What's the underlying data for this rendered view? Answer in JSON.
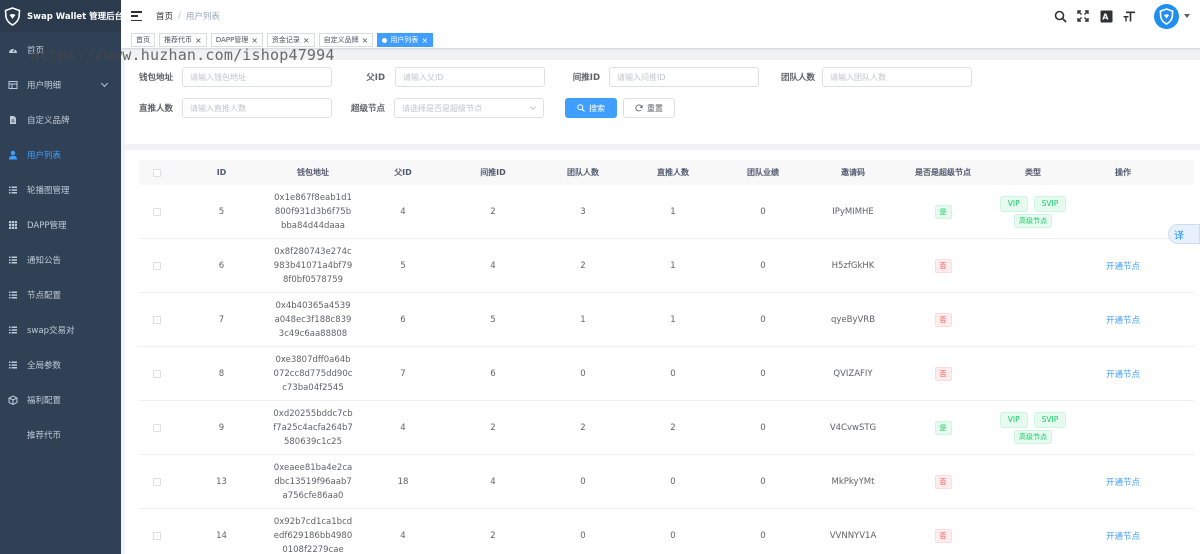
{
  "app": {
    "title": "Swap Wallet 管理后台"
  },
  "watermark": "https://www.huzhan.com/ishop47994",
  "sidebar": {
    "items": [
      {
        "label": "首页",
        "icon": "dashboard-icon",
        "active": false,
        "has_arrow": false
      },
      {
        "label": "用户明细",
        "icon": "table-icon",
        "active": false,
        "has_arrow": true
      },
      {
        "label": "自定义品牌",
        "icon": "document-icon",
        "active": false,
        "has_arrow": false
      },
      {
        "label": "用户列表",
        "icon": "user-icon",
        "active": true,
        "has_arrow": false
      },
      {
        "label": "轮播图管理",
        "icon": "list-icon",
        "active": false,
        "has_arrow": false
      },
      {
        "label": "DAPP管理",
        "icon": "grid-icon",
        "active": false,
        "has_arrow": false
      },
      {
        "label": "通知公告",
        "icon": "list-icon",
        "active": false,
        "has_arrow": false
      },
      {
        "label": "节点配置",
        "icon": "list-icon",
        "active": false,
        "has_arrow": false
      },
      {
        "label": "swap交易对",
        "icon": "list-icon",
        "active": false,
        "has_arrow": false
      },
      {
        "label": "全局参数",
        "icon": "list-icon",
        "active": false,
        "has_arrow": false
      },
      {
        "label": "福利配置",
        "icon": "box-icon",
        "active": false,
        "has_arrow": false
      },
      {
        "label": "推荐代币",
        "icon": "",
        "active": false,
        "has_arrow": false
      }
    ]
  },
  "navbar": {
    "breadcrumb": [
      "首页",
      "用户列表"
    ]
  },
  "tags": [
    {
      "label": "首页",
      "closable": false,
      "active": false
    },
    {
      "label": "推荐代币",
      "closable": true,
      "active": false
    },
    {
      "label": "DAPP管理",
      "closable": true,
      "active": false
    },
    {
      "label": "资金记录",
      "closable": true,
      "active": false
    },
    {
      "label": "自定义品牌",
      "closable": true,
      "active": false
    },
    {
      "label": "用户列表",
      "closable": true,
      "active": true
    }
  ],
  "search": {
    "fields": {
      "wallet": {
        "label": "钱包地址",
        "placeholder": "请输入钱包地址"
      },
      "parent": {
        "label": "父ID",
        "placeholder": "请输入父ID"
      },
      "indirect": {
        "label": "间推ID",
        "placeholder": "请输入间推ID"
      },
      "team": {
        "label": "团队人数",
        "placeholder": "请输入团队人数"
      },
      "direct": {
        "label": "直推人数",
        "placeholder": "请输入直推人数"
      },
      "super": {
        "label": "超级节点",
        "placeholder": "请选择是否是超级节点"
      }
    },
    "search_button": "搜索",
    "reset_button": "重置"
  },
  "table": {
    "columns": [
      "ID",
      "钱包地址",
      "父ID",
      "间推ID",
      "团队人数",
      "直推人数",
      "团队业绩",
      "邀请码",
      "是否是超级节点",
      "类型",
      "操作"
    ],
    "rows": [
      {
        "id": "5",
        "wallet": "0x1e867f8eab1d1800f931d3b6f75bbba84d44daaa",
        "parent": "4",
        "indirect": "2",
        "team": "3",
        "direct": "1",
        "perf": "0",
        "code": "IPyMIMHE",
        "super": "是",
        "is_super": true,
        "types": [
          "VIP",
          "SVIP",
          "高级节点"
        ],
        "action": ""
      },
      {
        "id": "6",
        "wallet": "0x8f280743e274c983b41071a4bf798f0bf0578759",
        "parent": "5",
        "indirect": "4",
        "team": "2",
        "direct": "1",
        "perf": "0",
        "code": "H5zfGkHK",
        "super": "否",
        "is_super": false,
        "types": [],
        "action": "开通节点"
      },
      {
        "id": "7",
        "wallet": "0x4b40365a4539a048ec3f188c8393c49c6aa88808",
        "parent": "6",
        "indirect": "5",
        "team": "1",
        "direct": "1",
        "perf": "0",
        "code": "qyeByVRB",
        "super": "否",
        "is_super": false,
        "types": [],
        "action": "开通节点"
      },
      {
        "id": "8",
        "wallet": "0xe3807dff0a64b072cc8d775dd90cc73ba04f2545",
        "parent": "7",
        "indirect": "6",
        "team": "0",
        "direct": "0",
        "perf": "0",
        "code": "QVIZAFIY",
        "super": "否",
        "is_super": false,
        "types": [],
        "action": "开通节点"
      },
      {
        "id": "9",
        "wallet": "0xd20255bddc7cbf7a25c4acfa264b7580639c1c25",
        "parent": "4",
        "indirect": "2",
        "team": "2",
        "direct": "2",
        "perf": "0",
        "code": "V4CvwSTG",
        "super": "是",
        "is_super": true,
        "types": [
          "VIP",
          "SVIP",
          "高级节点"
        ],
        "action": ""
      },
      {
        "id": "13",
        "wallet": "0xeaee81ba4e2cadbc13519f96aab7a756cfe86aa0",
        "parent": "18",
        "indirect": "4",
        "team": "0",
        "direct": "0",
        "perf": "0",
        "code": "MkPkyYMt",
        "super": "否",
        "is_super": false,
        "types": [],
        "action": "开通节点"
      },
      {
        "id": "14",
        "wallet": "0x92b7cd1ca1bcdedf629186bb49800108f2279cae",
        "parent": "4",
        "indirect": "2",
        "team": "0",
        "direct": "0",
        "perf": "0",
        "code": "VVNNYV1A",
        "super": "否",
        "is_super": false,
        "types": [],
        "action": "开通节点"
      }
    ]
  },
  "translate_button": "译"
}
